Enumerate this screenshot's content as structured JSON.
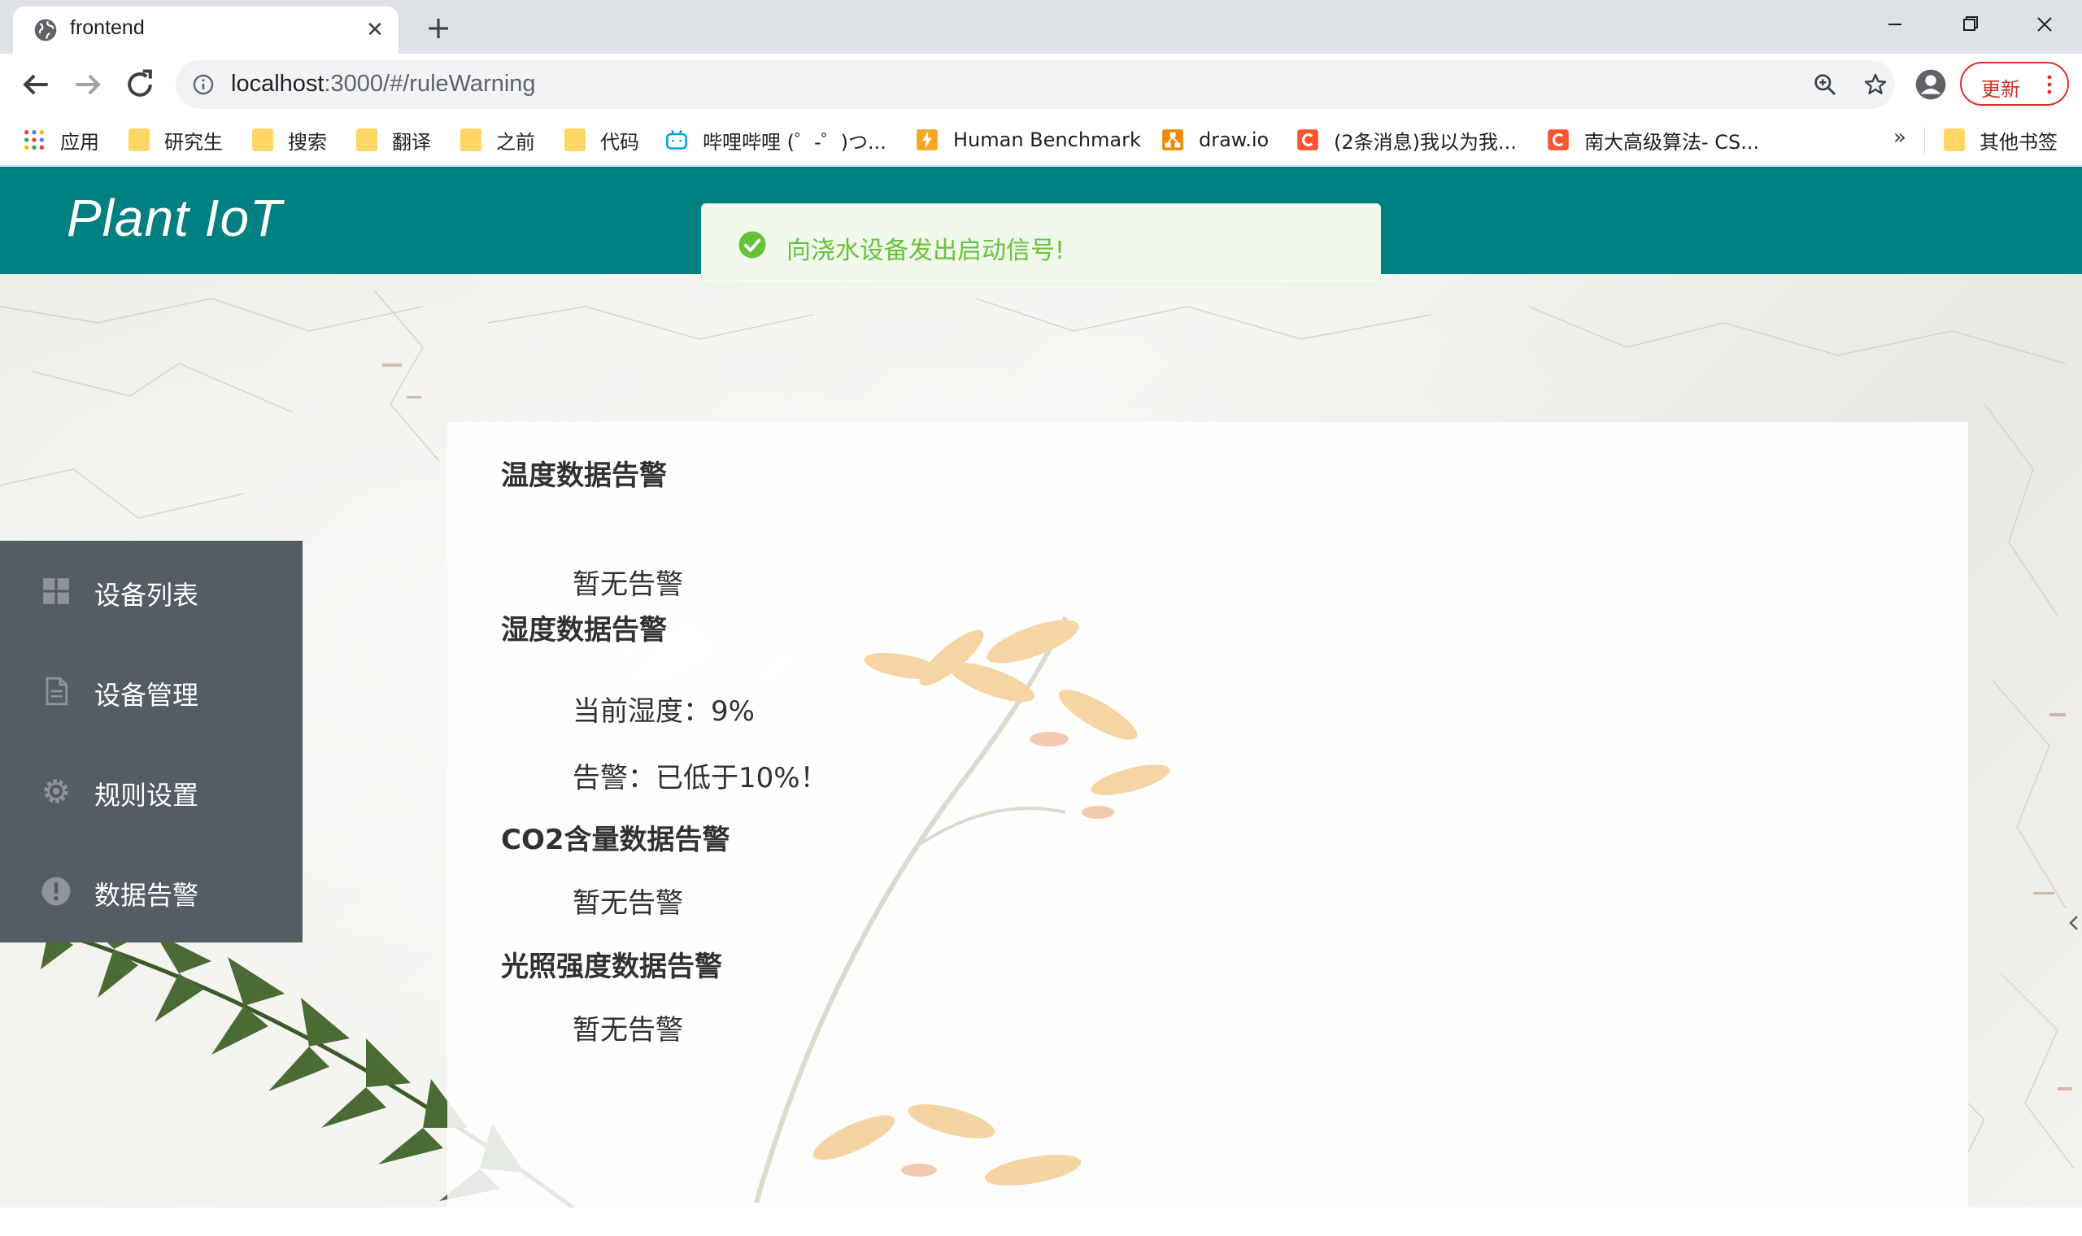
{
  "browser": {
    "tab_title": "frontend",
    "url_host": "localhost",
    "url_path": ":3000/#/ruleWarning",
    "update_label": "更新",
    "bookmarks": [
      {
        "label": "应用",
        "icon": "apps-grid-icon"
      },
      {
        "label": "研究生",
        "icon": "folder-icon"
      },
      {
        "label": "搜索",
        "icon": "folder-icon"
      },
      {
        "label": "翻译",
        "icon": "folder-icon"
      },
      {
        "label": "之前",
        "icon": "folder-icon"
      },
      {
        "label": "代码",
        "icon": "folder-icon"
      },
      {
        "label": "哔哩哔哩 (゜-゜)つ...",
        "icon": "bilibili-icon"
      },
      {
        "label": "Human Benchmark",
        "icon": "lightning-icon"
      },
      {
        "label": "draw.io",
        "icon": "drawio-icon"
      },
      {
        "label": "(2条消息)我以为我...",
        "icon": "csdn-icon"
      },
      {
        "label": "南大高级算法- CS...",
        "icon": "csdn-icon"
      }
    ],
    "bookmarks_more": "»",
    "other_bookmarks": "其他书签"
  },
  "app": {
    "title": "Plant IoT",
    "header_color": "#008080",
    "sidebar_color": "#545c64"
  },
  "sidebar": {
    "items": [
      {
        "label": "设备列表",
        "icon": "grid-icon"
      },
      {
        "label": "设备管理",
        "icon": "document-icon"
      },
      {
        "label": "规则设置",
        "icon": "gear-icon"
      },
      {
        "label": "数据告警",
        "icon": "warning-icon"
      }
    ]
  },
  "toast": {
    "message": "向浇水设备发出启动信号!",
    "type": "success",
    "color": "#67c23a"
  },
  "warnings": {
    "temperature": {
      "title": "温度数据告警",
      "line": "暂无告警"
    },
    "humidity": {
      "title": "湿度数据告警",
      "current": "当前湿度：9%",
      "alert": "告警：已低于10%！"
    },
    "co2": {
      "title": "CO2含量数据告警",
      "line": "暂无告警"
    },
    "light": {
      "title": "光照强度数据告警",
      "line": "暂无告警"
    }
  }
}
